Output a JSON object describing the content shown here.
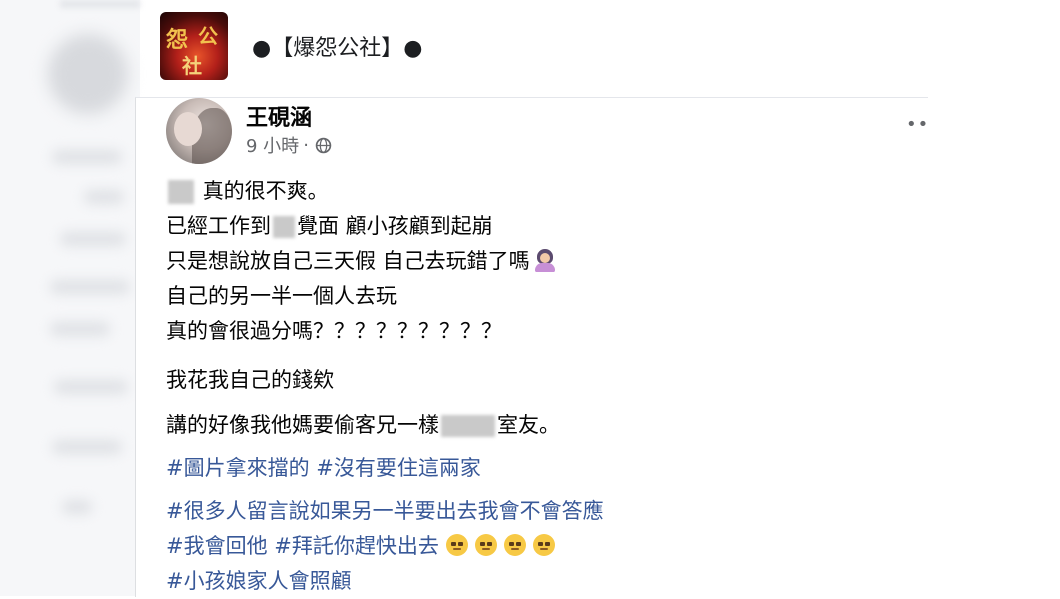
{
  "group": {
    "name": "●【爆怨公社】●",
    "logo_glyphs": [
      "怨",
      "公",
      "社"
    ]
  },
  "post": {
    "author": "王硯涵",
    "time": "9 小時",
    "separator": "·",
    "privacy_icon": "globe-icon",
    "more_label": "••",
    "lines": {
      "l1": "真的很不爽。",
      "l2a": "已經工作到",
      "l2b": "覺面 顧小孩顧到起崩",
      "l3": "只是想說放自己三天假 自己去玩錯了嗎",
      "l4": "自己的另一半一個人去玩",
      "l5": "真的會很過分嗎？？？？？？？？？",
      "l6": "我花我自己的錢欸",
      "l7a": "講的好像我他媽要偷客兄一樣",
      "l7b": "室友。"
    },
    "hashtags": {
      "h1": "#圖片拿來擋的 #沒有要住這兩家",
      "h2": "#很多人留言說如果另一半要出去我會不會答應",
      "h3": "#我會回他 #拜託你趕快出去",
      "h4": "#小孩娘家人會照顧"
    }
  },
  "colors": {
    "hashtag": "#385898",
    "meta_text": "#65676b",
    "body_text": "#050505"
  }
}
